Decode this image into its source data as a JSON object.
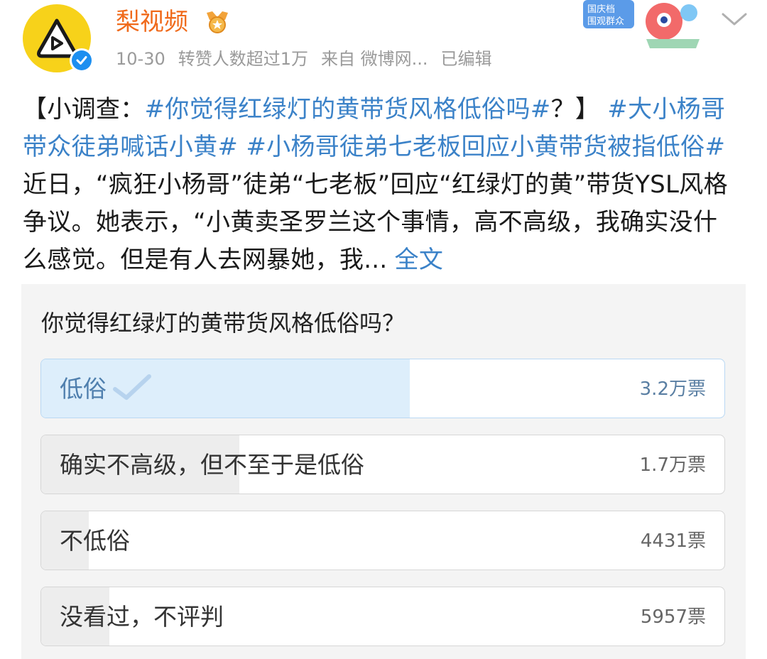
{
  "header": {
    "account_name": "梨视频",
    "date": "10-30",
    "repost_info": "转赞人数超过1万",
    "source": "来自 微博网...",
    "edited": "已编辑",
    "banner_text": "国庆档 围观群众",
    "accent_color": "#f06a1b",
    "avatar_color": "#f7d21a",
    "verified_color": "#1d8ff0"
  },
  "post": {
    "prefix": "【小调查：",
    "tag1": "#你觉得红绿灯的黄带货风格低俗吗#",
    "suffix": "？】",
    "tag2": "#大小杨哥带众徒弟喊话小黄#",
    "tag3": "#小杨哥徒弟七老板回应小黄带货被指低俗#",
    "body": "近日，“疯狂小杨哥”徒弟“七老板”回应“红绿灯的黄”带货YSL风格争议。她表示，“小黄卖圣罗兰这个事情，高不高级，我确实没什么感觉。但是有人去网暴她，我...",
    "more": "全文",
    "link_color": "#3b82c8"
  },
  "poll": {
    "question": "你觉得红绿灯的黄带货风格低俗吗？",
    "options": [
      {
        "label": "低俗",
        "count": "3.2万票",
        "share": 0.54,
        "selected": true
      },
      {
        "label": "确实不高级，但不至于是低俗",
        "count": "1.7万票",
        "share": 0.29,
        "selected": false
      },
      {
        "label": "不低俗",
        "count": "4431票",
        "share": 0.07,
        "selected": false
      },
      {
        "label": "没看过，不评判",
        "count": "5957票",
        "share": 0.1,
        "selected": false
      }
    ],
    "selected_fill_color": "#ddeefb",
    "fill_color": "#ededed"
  },
  "icons": {
    "avatar": "play-icon",
    "verified": "verified-check-icon",
    "medal": "medal-icon",
    "selected": "check-icon",
    "menu": "chevron-down-icon"
  }
}
